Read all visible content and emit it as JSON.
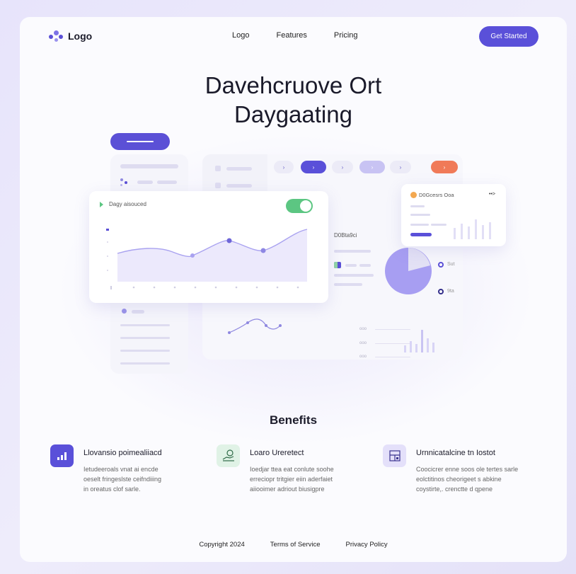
{
  "nav": {
    "logo_text": "Logo",
    "links": [
      "Logo",
      "Features",
      "Pricing"
    ],
    "cta_label": "Get Started"
  },
  "hero": {
    "title_line1": "Davehcruove Ort",
    "title_line2": "Daygaating"
  },
  "dashboard": {
    "chart_card_title": "Dagy aisouced",
    "right_card_title": "D0Gcesrs Ooa",
    "right_card_action": "••>",
    "stat_label": "D0Bta9ci",
    "pie_legend_1": "Sut",
    "pie_legend_2": "9ta",
    "row_labels": [
      "ooo",
      "ooo",
      "ooo"
    ],
    "toggle_on": true
  },
  "benefits": {
    "title": "Benefits",
    "items": [
      {
        "icon": "bar-chart-icon",
        "title": "Llovansio poimealiiacd",
        "lines": [
          "Ietudeeroals vnat ai encde",
          "oeselt fringeslste ceifndiiing",
          "in oreatus clof sarle."
        ]
      },
      {
        "icon": "coin-hand-icon",
        "title": "Loaro Ureretect",
        "lines": [
          "Ioedjar ttea eat conlute soohe",
          "erreciopr tritgier eiin aderfaiet",
          "aiiooimer adriout biusigpre"
        ]
      },
      {
        "icon": "layout-grid-icon",
        "title": "Urnnicatalcine tn Iostot",
        "lines": [
          "Coocicrer enne soos ole tertes sarle",
          "eolctitinos cheorigeet s abkine",
          "coystirte,. crenctte d qpene"
        ]
      }
    ]
  },
  "footer": {
    "links": [
      "Copyright 2024",
      "Terms of Service",
      "Privacy Policy"
    ]
  },
  "colors": {
    "accent": "#5a50d9",
    "accent_light": "#a9a2f0",
    "toggle": "#5cc682",
    "pie": "#a79ef2",
    "orange": "#f07a58"
  }
}
